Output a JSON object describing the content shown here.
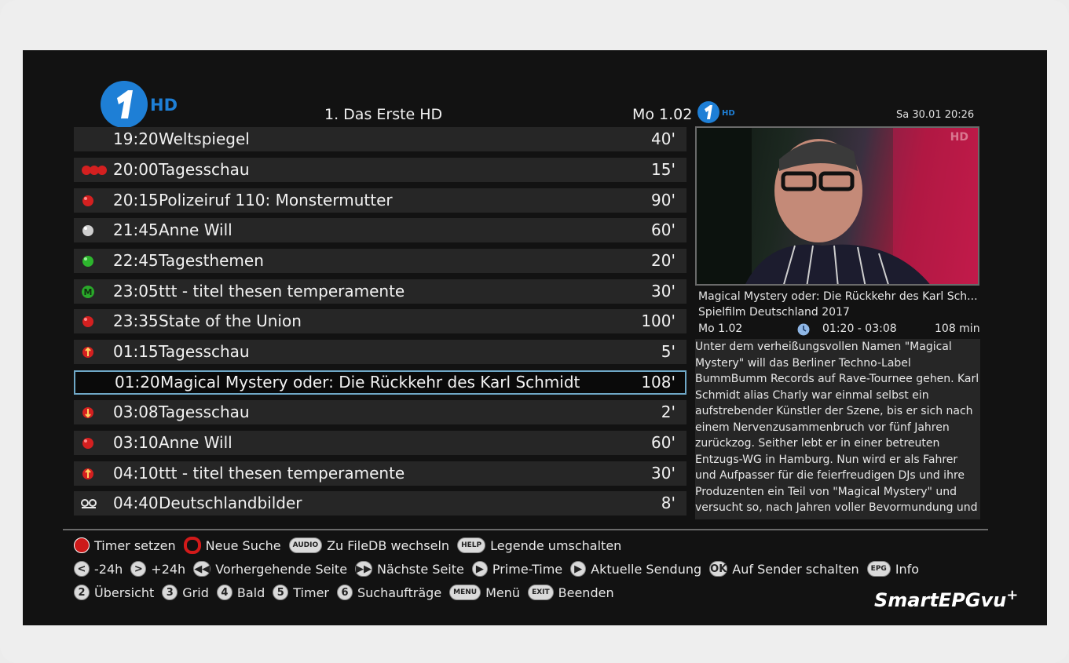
{
  "header": {
    "channel_name": "1. Das Erste HD",
    "list_date": "Mo 1.02",
    "current_datetime": "Sa 30.01  20:26",
    "logo_text": "HD"
  },
  "events": [
    {
      "icon": "none",
      "time": "19:20",
      "title": "Weltspiegel",
      "duration": "40'"
    },
    {
      "icon": "timer-series-icon",
      "time": "20:00",
      "title": "Tagesschau",
      "duration": "15'"
    },
    {
      "icon": "timer-red-icon",
      "time": "20:15",
      "title": "Polizeiruf 110: Monstermutter",
      "duration": "90'"
    },
    {
      "icon": "timer-grey-icon",
      "time": "21:45",
      "title": "Anne Will",
      "duration": "60'"
    },
    {
      "icon": "timer-green-icon",
      "time": "22:45",
      "title": "Tagesthemen",
      "duration": "20'"
    },
    {
      "icon": "marker-m-icon",
      "time": "23:05",
      "title": "ttt - titel thesen temperamente",
      "duration": "30'"
    },
    {
      "icon": "timer-red-icon",
      "time": "23:35",
      "title": "State of the Union",
      "duration": "100'"
    },
    {
      "icon": "timer-start-icon",
      "time": "01:15",
      "title": "Tagesschau",
      "duration": "5'"
    },
    {
      "icon": "none",
      "time": "01:20",
      "title": "Magical Mystery oder: Die Rückkehr des Karl Schmidt",
      "duration": "108'",
      "selected": true
    },
    {
      "icon": "timer-end-icon",
      "time": "03:08",
      "title": "Tagesschau",
      "duration": "2'"
    },
    {
      "icon": "timer-red-icon",
      "time": "03:10",
      "title": "Anne Will",
      "duration": "60'"
    },
    {
      "icon": "timer-start-icon",
      "time": "04:10",
      "title": "ttt - titel thesen temperamente",
      "duration": "30'"
    },
    {
      "icon": "recording-icon",
      "time": "04:40",
      "title": "Deutschlandbilder",
      "duration": "8'"
    }
  ],
  "info": {
    "preview_badge": "HD",
    "title": "Magical Mystery oder: Die Rückkehr des Karl Sch...",
    "genre": "Spielfilm Deutschland 2017",
    "date": "Mo 1.02",
    "time_range": "01:20 - 03:08",
    "length": "108 min",
    "description": "Unter dem verheißungsvollen Namen \"Magical Mystery\" will das Berliner Techno-Label BummBumm Records auf Rave-Tournee gehen. Karl Schmidt alias Charly war einmal selbst ein aufstrebender Künstler der Szene, bis er sich nach einem Nervenzusammenbruch vor fünf Jahren zurückzog. Seither lebt er in einer betreuten Entzugs-WG in Hamburg. Nun wird er als Fahrer und Aufpasser für die feierfreudigen DJs und ihre Produzenten ein Teil von \"Magical Mystery\" und versucht so, nach Jahren voller Bevormundung und"
  },
  "keys": {
    "row1": [
      {
        "key": "",
        "style": "red",
        "label": "Timer setzen"
      },
      {
        "key": "",
        "style": "ring",
        "label": "Neue Suche"
      },
      {
        "key": "AUDIO",
        "style": "pill",
        "label": "Zu FileDB wechseln"
      },
      {
        "key": "HELP",
        "style": "pill",
        "label": "Legende umschalten"
      }
    ],
    "row2": [
      {
        "key": "<",
        "style": "round",
        "label": "-24h"
      },
      {
        "key": ">",
        "style": "round",
        "label": "+24h"
      },
      {
        "key": "◀◀",
        "style": "round",
        "label": "Vorhergehende Seite"
      },
      {
        "key": "▶▶",
        "style": "round",
        "label": "Nächste Seite"
      },
      {
        "key": "▶",
        "style": "round",
        "label": "Prime-Time"
      },
      {
        "key": "▶",
        "style": "round",
        "label": "Aktuelle Sendung"
      },
      {
        "key": "OK",
        "style": "round",
        "label": "Auf Sender schalten"
      },
      {
        "key": "EPG",
        "style": "pill",
        "label": "Info"
      }
    ],
    "row3": [
      {
        "key": "2",
        "style": "round",
        "label": "Übersicht"
      },
      {
        "key": "3",
        "style": "round",
        "label": "Grid"
      },
      {
        "key": "4",
        "style": "round",
        "label": "Bald"
      },
      {
        "key": "5",
        "style": "round",
        "label": "Timer"
      },
      {
        "key": "6",
        "style": "round",
        "label": "Suchaufträge"
      },
      {
        "key": "MENU",
        "style": "pill",
        "label": "Menü"
      },
      {
        "key": "EXIT",
        "style": "pill",
        "label": "Beenden"
      }
    ]
  },
  "brand": {
    "name": "SmartEPGvu",
    "suffix": "+"
  }
}
